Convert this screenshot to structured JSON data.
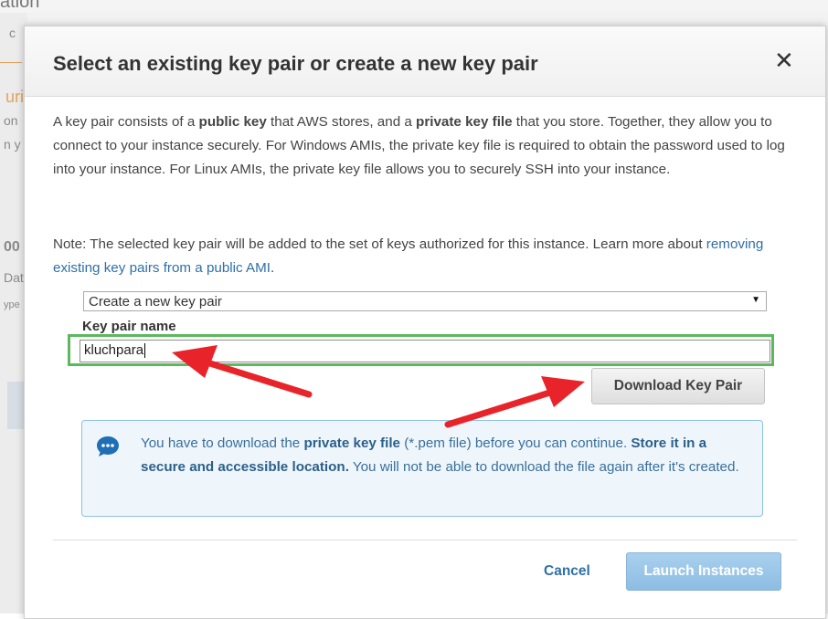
{
  "background_fragments": {
    "top": "ation",
    "f1": "c",
    "f2": "uri",
    "f3": "on",
    "f4": "n y",
    "f5": "00",
    "f6": "Dat",
    "f7": "ype"
  },
  "modal": {
    "title": "Select an existing key pair or create a new key pair",
    "close_symbol": "✕",
    "intro": {
      "t1": "A key pair consists of a ",
      "b1": "public key",
      "t2": " that AWS stores, and a ",
      "b2": "private key file",
      "t3": " that you store. Together, they allow you to connect to your instance securely. For Windows AMIs, the private key file is required to obtain the password used to log into your instance. For Linux AMIs, the private key file allows you to securely SSH into your instance."
    },
    "note": {
      "text": "Note: The selected key pair will be added to the set of keys authorized for this instance. Learn more about ",
      "link": "removing existing key pairs from a public AMI",
      "end": "."
    },
    "key_pair_select": {
      "selected": "Create a new key pair",
      "arrow": "▼"
    },
    "key_pair_name": {
      "label": "Key pair name",
      "value": "kluchpara"
    },
    "download_button": "Download Key Pair",
    "info": {
      "icon": "chat-bubble-icon",
      "t1": "You have to download the ",
      "b1": "private key file",
      "t2": " (*.pem file) before you can continue. ",
      "b2": "Store it in a secure and accessible location.",
      "t3": " You will not be able to download the file again after it's created."
    },
    "cancel_button": "Cancel",
    "launch_button": "Launch Instances"
  },
  "colors": {
    "highlight": "#5cb85c",
    "annotation_arrow": "#e8232a",
    "info_bg": "#eef6fc",
    "info_border": "#8cc1e5",
    "link": "#2f6fa7",
    "launch_disabled": "#9fcaea"
  }
}
